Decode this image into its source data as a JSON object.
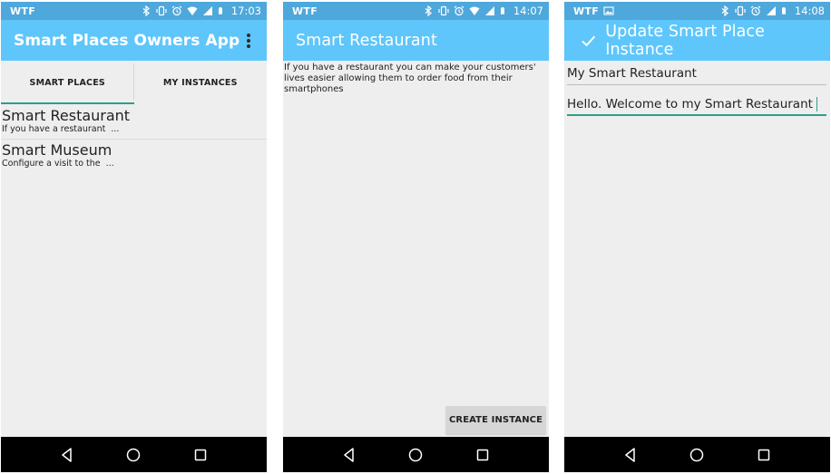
{
  "screens": [
    {
      "status": {
        "carrier": "WTF",
        "time": "17:03"
      },
      "appbar": {
        "title": "Smart Places Owners App",
        "overflow_icon": "more-vert-icon"
      },
      "tabs": [
        {
          "label": "SMART PLACES",
          "active": true
        },
        {
          "label": "MY INSTANCES",
          "active": false
        }
      ],
      "list": [
        {
          "title": "Smart Restaurant",
          "subtitle": "If you have a restaurant  ..."
        },
        {
          "title": "Smart Museum",
          "subtitle": "Configure a visit to the  ..."
        }
      ]
    },
    {
      "status": {
        "carrier": "WTF",
        "time": "14:07"
      },
      "appbar": {
        "title": "Smart Restaurant"
      },
      "description": "If you have a restaurant you can make your customers' lives easier allowing them to order food from their smartphones",
      "create_button": "CREATE INSTANCE"
    },
    {
      "status": {
        "carrier": "WTF",
        "time": "14:08"
      },
      "appbar": {
        "title": "Update Smart Place Instance",
        "check_icon": "check-icon"
      },
      "fields": [
        {
          "value": "My Smart Restaurant",
          "focused": false
        },
        {
          "value": "Hello. Welcome to my Smart Restaurant",
          "focused": true
        }
      ]
    }
  ],
  "colors": {
    "status_bar": "#4ea8dc",
    "app_bar": "#5ec6fb",
    "accent": "#2d9f8a",
    "background": "#eeeeee",
    "nav_bar": "#000000"
  },
  "navbar": {
    "icons": [
      "back-icon",
      "home-icon",
      "recents-icon"
    ]
  }
}
